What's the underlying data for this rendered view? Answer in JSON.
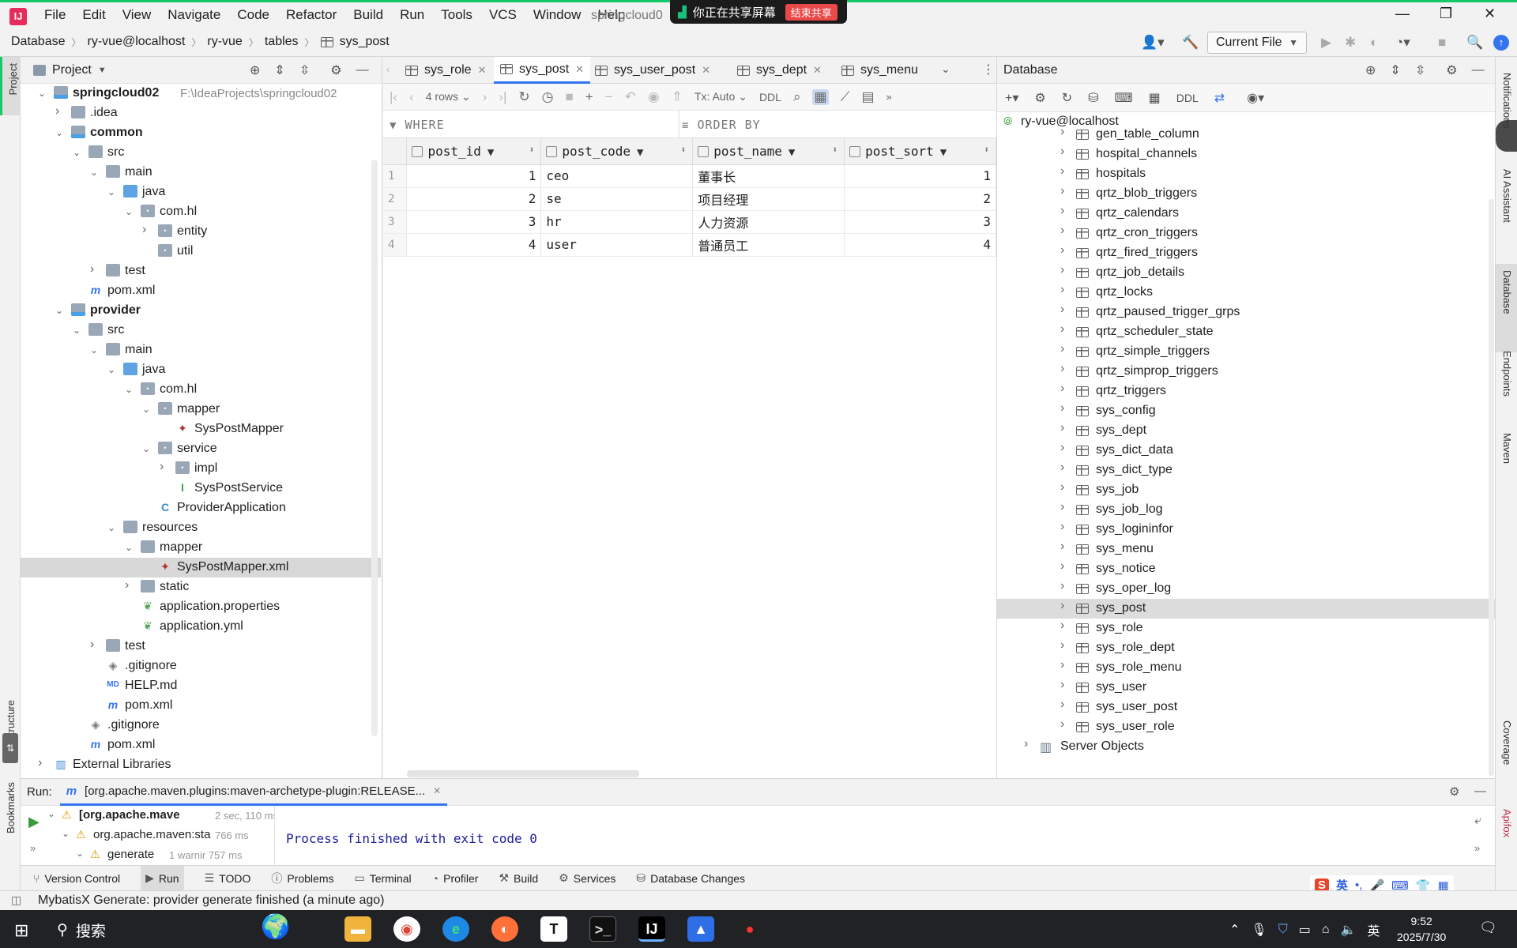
{
  "menubar": {
    "items": [
      "File",
      "Edit",
      "View",
      "Navigate",
      "Code",
      "Refactor",
      "Build",
      "Run",
      "Tools",
      "VCS",
      "Window",
      "Help"
    ],
    "title": "springcloud0"
  },
  "share": {
    "text": "你正在共享屏幕",
    "stop": "结束共享"
  },
  "breadcrumb": [
    "Database",
    "ry-vue@localhost",
    "ry-vue",
    "tables",
    "sys_post"
  ],
  "run_config": "Current File",
  "left_strip": {
    "project": "Project",
    "structure": "Structure",
    "bookmarks": "Bookmarks"
  },
  "right_strip": [
    "Notifications",
    "AI Assistant",
    "Database",
    "Endpoints",
    "Maven",
    "Coverage",
    "Apifox"
  ],
  "project": {
    "title": "Project",
    "tree": [
      {
        "d": 0,
        "e": "open",
        "i": "mod",
        "t": "springcloud02",
        "b": true,
        "p": "F:\\IdeaProjects\\springcloud02"
      },
      {
        "d": 1,
        "e": "closed",
        "i": "folder",
        "t": ".idea"
      },
      {
        "d": 1,
        "e": "open",
        "i": "mod",
        "t": "common",
        "b": true
      },
      {
        "d": 2,
        "e": "open",
        "i": "folder",
        "t": "src"
      },
      {
        "d": 3,
        "e": "open",
        "i": "folder",
        "t": "main"
      },
      {
        "d": 4,
        "e": "open",
        "i": "blue",
        "t": "java"
      },
      {
        "d": 5,
        "e": "open",
        "i": "pkg",
        "t": "com.hl"
      },
      {
        "d": 6,
        "e": "closed",
        "i": "pkg",
        "t": "entity"
      },
      {
        "d": 6,
        "e": "none",
        "i": "pkg",
        "t": "util"
      },
      {
        "d": 3,
        "e": "closed",
        "i": "folder",
        "t": "test"
      },
      {
        "d": 2,
        "e": "none",
        "i": "maven",
        "t": "pom.xml"
      },
      {
        "d": 1,
        "e": "open",
        "i": "mod",
        "t": "provider",
        "b": true
      },
      {
        "d": 2,
        "e": "open",
        "i": "folder",
        "t": "src"
      },
      {
        "d": 3,
        "e": "open",
        "i": "folder",
        "t": "main"
      },
      {
        "d": 4,
        "e": "open",
        "i": "blue",
        "t": "java"
      },
      {
        "d": 5,
        "e": "open",
        "i": "pkg",
        "t": "com.hl"
      },
      {
        "d": 6,
        "e": "open",
        "i": "pkg",
        "t": "mapper"
      },
      {
        "d": 7,
        "e": "none",
        "i": "bird",
        "t": "SysPostMapper"
      },
      {
        "d": 6,
        "e": "open",
        "i": "pkg",
        "t": "service"
      },
      {
        "d": 7,
        "e": "closed",
        "i": "pkg",
        "t": "impl"
      },
      {
        "d": 7,
        "e": "none",
        "i": "iface",
        "t": "SysPostService"
      },
      {
        "d": 6,
        "e": "none",
        "i": "class",
        "t": "ProviderApplication"
      },
      {
        "d": 4,
        "e": "open",
        "i": "res",
        "t": "resources"
      },
      {
        "d": 5,
        "e": "open",
        "i": "folder",
        "t": "mapper"
      },
      {
        "d": 6,
        "e": "none",
        "i": "bird",
        "t": "SysPostMapper.xml",
        "s": true
      },
      {
        "d": 5,
        "e": "closed",
        "i": "folder",
        "t": "static"
      },
      {
        "d": 5,
        "e": "none",
        "i": "spring",
        "t": "application.properties"
      },
      {
        "d": 5,
        "e": "none",
        "i": "spring",
        "t": "application.yml"
      },
      {
        "d": 3,
        "e": "closed",
        "i": "folder",
        "t": "test"
      },
      {
        "d": 3,
        "e": "none",
        "i": "git",
        "t": ".gitignore"
      },
      {
        "d": 3,
        "e": "none",
        "i": "md",
        "t": "HELP.md"
      },
      {
        "d": 3,
        "e": "none",
        "i": "maven",
        "t": "pom.xml"
      },
      {
        "d": 2,
        "e": "none",
        "i": "git",
        "t": ".gitignore"
      },
      {
        "d": 2,
        "e": "none",
        "i": "maven",
        "t": "pom.xml"
      },
      {
        "d": 0,
        "e": "closed",
        "i": "lib",
        "t": "External Libraries"
      }
    ]
  },
  "editor_tabs": [
    {
      "label": "sys_role",
      "active": false
    },
    {
      "label": "sys_post",
      "active": true
    },
    {
      "label": "sys_user_post",
      "active": false
    },
    {
      "label": "sys_dept",
      "active": false
    },
    {
      "label": "sys_menu",
      "active": false
    }
  ],
  "grid_toolbar": {
    "rows": "4 rows",
    "tx": "Tx: Auto",
    "ddl": "DDL"
  },
  "filter": {
    "where": "WHERE",
    "order": "ORDER BY"
  },
  "grid": {
    "columns": [
      "post_id",
      "post_code",
      "post_name",
      "post_sort"
    ],
    "rows": [
      [
        "1",
        "1",
        "ceo",
        "董事长",
        "1"
      ],
      [
        "2",
        "2",
        "se",
        "项目经理",
        "2"
      ],
      [
        "3",
        "3",
        "hr",
        "人力资源",
        "3"
      ],
      [
        "4",
        "4",
        "user",
        "普通员工",
        "4"
      ]
    ]
  },
  "database": {
    "title": "Database",
    "ddl": "DDL",
    "root": "ry-vue@localhost",
    "tables": [
      "gen_table_column",
      "hospital_channels",
      "hospitals",
      "qrtz_blob_triggers",
      "qrtz_calendars",
      "qrtz_cron_triggers",
      "qrtz_fired_triggers",
      "qrtz_job_details",
      "qrtz_locks",
      "qrtz_paused_trigger_grps",
      "qrtz_scheduler_state",
      "qrtz_simple_triggers",
      "qrtz_simprop_triggers",
      "qrtz_triggers",
      "sys_config",
      "sys_dept",
      "sys_dict_data",
      "sys_dict_type",
      "sys_job",
      "sys_job_log",
      "sys_logininfor",
      "sys_menu",
      "sys_notice",
      "sys_oper_log",
      "sys_post",
      "sys_role",
      "sys_role_dept",
      "sys_role_menu",
      "sys_user",
      "sys_user_post",
      "sys_user_role"
    ],
    "selected": "sys_post",
    "server_objects": "Server Objects"
  },
  "run": {
    "label": "Run:",
    "tab": "[org.apache.maven.plugins:maven-archetype-plugin:RELEASE...",
    "tree": [
      {
        "t": "[org.apache.mave",
        "time": "2 sec, 110 ms"
      },
      {
        "t": "org.apache.maven:sta",
        "time": "766 ms"
      },
      {
        "t": "generate",
        "time": "1 warnir 757 ms"
      }
    ],
    "console": "Process finished with exit code 0"
  },
  "bottom_tabs": [
    "Version Control",
    "Run",
    "TODO",
    "Problems",
    "Terminal",
    "Profiler",
    "Build",
    "Services",
    "Database Changes"
  ],
  "status": "MybatisX Generate: provider generate finished (a minute ago)",
  "taskbar": {
    "search": "搜索",
    "time": "9:52",
    "date": "2025/7/30",
    "lang": "英",
    "ime": "英"
  },
  "colors": {
    "accent": "#3574f0",
    "selection": "#d8d8d8",
    "share_green": "#13c96a",
    "taskbar": "#202226"
  }
}
